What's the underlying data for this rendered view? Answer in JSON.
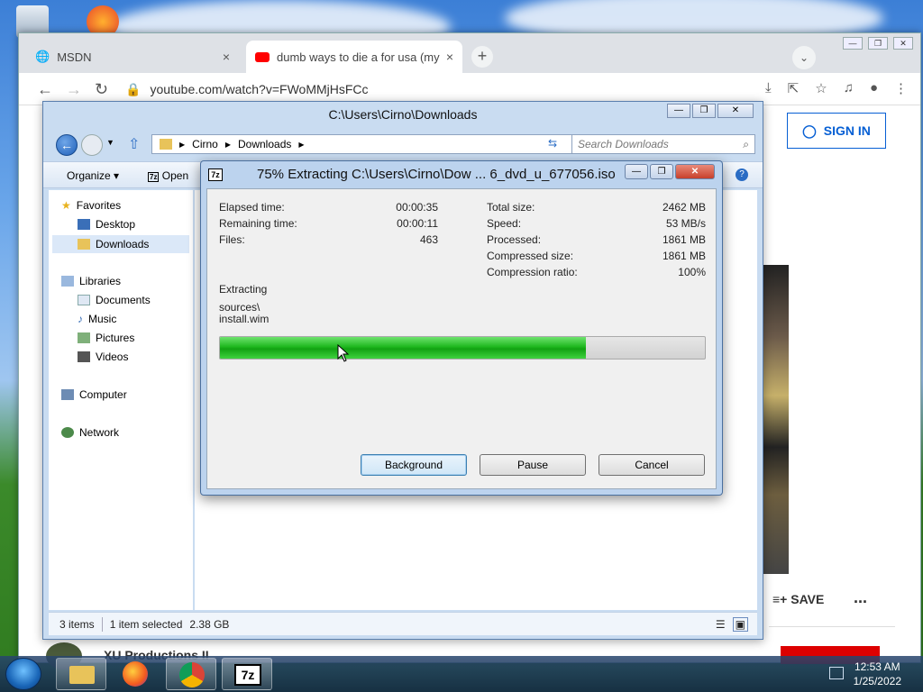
{
  "chrome": {
    "tabs": [
      {
        "title": "MSDN",
        "close": "×"
      },
      {
        "title": "dumb ways to die a for usa (my",
        "close": "×"
      }
    ],
    "new_tab": "+",
    "url": "youtube.com/watch?v=FWoMMjHsFCc",
    "sign_in": "SIGN IN",
    "save": "SAVE",
    "more": "...",
    "channel": "XU Productions II"
  },
  "explorer": {
    "title": "C:\\Users\\Cirno\\Downloads",
    "breadcrumb": [
      "Cirno",
      "Downloads"
    ],
    "search_placeholder": "Search Downloads",
    "toolbar": {
      "organize": "Organize",
      "open": "Open"
    },
    "nav": {
      "favorites": "Favorites",
      "desktop": "Desktop",
      "downloads": "Downloads",
      "libraries": "Libraries",
      "documents": "Documents",
      "music": "Music",
      "pictures": "Pictures",
      "videos": "Videos",
      "computer": "Computer",
      "network": "Network"
    },
    "status": {
      "items": "3 items",
      "selected": "1 item selected",
      "size": "2.38 GB"
    }
  },
  "zip": {
    "title": "75% Extracting C:\\Users\\Cirno\\Dow ... 6_dvd_u_677056.iso",
    "progress_fraction": 0.755,
    "left_stats": [
      {
        "label": "Elapsed time:",
        "value": "00:00:35"
      },
      {
        "label": "Remaining time:",
        "value": "00:00:11"
      },
      {
        "label": "Files:",
        "value": "463"
      }
    ],
    "right_stats": [
      {
        "label": "Total size:",
        "value": "2462 MB"
      },
      {
        "label": "Speed:",
        "value": "53 MB/s"
      },
      {
        "label": "Processed:",
        "value": "1861 MB"
      },
      {
        "label": "Compressed size:",
        "value": "1861 MB"
      },
      {
        "label": "Compression ratio:",
        "value": "100%"
      }
    ],
    "extracting_label": "Extracting",
    "path_line1": "sources\\",
    "path_line2": "install.wim",
    "buttons": {
      "background": "Background",
      "pause": "Pause",
      "cancel": "Cancel"
    }
  },
  "taskbar": {
    "time": "12:53 AM",
    "date": "1/25/2022",
    "zip_label": "7z"
  }
}
